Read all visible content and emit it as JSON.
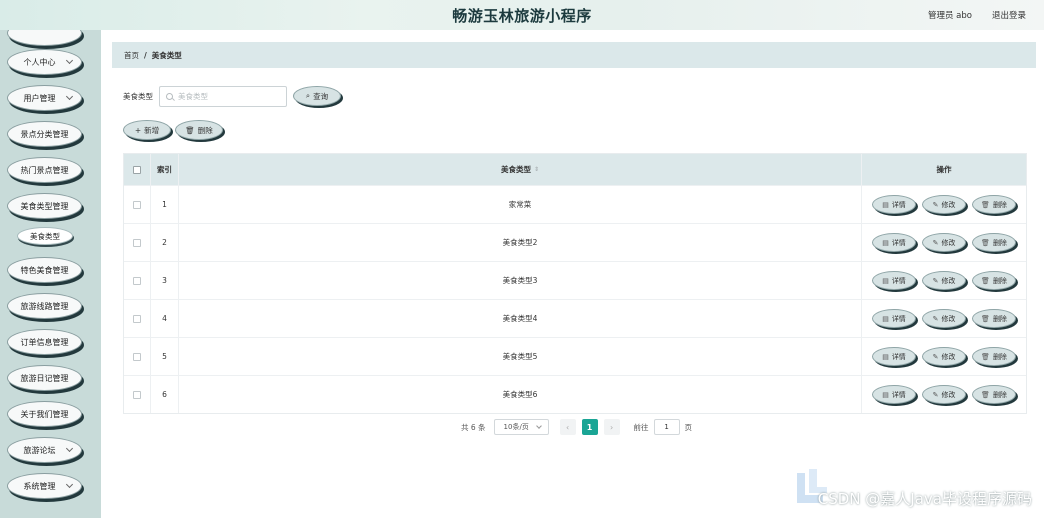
{
  "header": {
    "title": "畅游玉林旅游小程序",
    "user": "管理员 abo",
    "logout": "退出登录"
  },
  "sidebar": {
    "items": [
      {
        "label": "个人中心",
        "chevron": true
      },
      {
        "label": "用户管理",
        "chevron": true
      },
      {
        "label": "景点分类管理",
        "chevron": false
      },
      {
        "label": "热门景点管理",
        "chevron": false
      },
      {
        "label": "美食类型管理",
        "chevron": false
      },
      {
        "label": "特色美食管理",
        "chevron": false
      },
      {
        "label": "旅游线路管理",
        "chevron": false
      },
      {
        "label": "订单信息管理",
        "chevron": false
      },
      {
        "label": "旅游日记管理",
        "chevron": false
      },
      {
        "label": "关于我们管理",
        "chevron": false
      },
      {
        "label": "旅游论坛",
        "chevron": true
      },
      {
        "label": "系统管理",
        "chevron": true
      }
    ],
    "submenu": {
      "label": "美食类型"
    }
  },
  "breadcrumb": {
    "home": "首页",
    "separator": "/",
    "current": "美食类型"
  },
  "search": {
    "label": "美食类型",
    "placeholder": "美食类型",
    "button": "查询"
  },
  "actions": {
    "add": "新增",
    "delete": "删除"
  },
  "table": {
    "headers": {
      "index": "索引",
      "type": "美食类型",
      "ops": "操作"
    },
    "ops": {
      "detail": "详情",
      "edit": "修改",
      "delete": "删除"
    },
    "rows": [
      {
        "index": "1",
        "type": "家常菜"
      },
      {
        "index": "2",
        "type": "美食类型2"
      },
      {
        "index": "3",
        "type": "美食类型3"
      },
      {
        "index": "4",
        "type": "美食类型4"
      },
      {
        "index": "5",
        "type": "美食类型5"
      },
      {
        "index": "6",
        "type": "美食类型6"
      }
    ]
  },
  "pagination": {
    "total": "共 6 条",
    "page_size": "10条/页",
    "current_page": "1",
    "goto_label": "前往",
    "goto_value": "1",
    "page_suffix": "页"
  },
  "watermark": "CSDN @嘉人Java毕设程序源码"
}
